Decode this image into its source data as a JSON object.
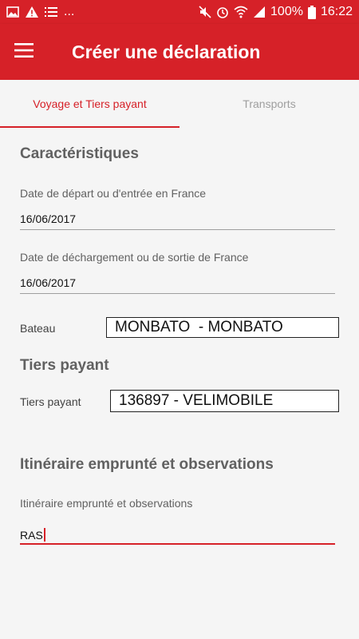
{
  "status_bar": {
    "left_icons": [
      "image-icon",
      "warning-icon",
      "list-icon"
    ],
    "overflow": "...",
    "battery_percent": "100%",
    "time": "16:22"
  },
  "app_bar": {
    "title": "Créer une déclaration"
  },
  "tabs": [
    {
      "label": "Voyage et Tiers payant",
      "active": true
    },
    {
      "label": "Transports",
      "active": false
    }
  ],
  "caracteristiques": {
    "title": "Caractéristiques",
    "date_depart": {
      "label": "Date de départ ou d'entrée en France",
      "value": "16/06/2017"
    },
    "date_dechargement": {
      "label": "Date de déchargement ou de sortie de France",
      "value": "16/06/2017"
    },
    "bateau": {
      "label": "Bateau",
      "value": "MONBATO  - MONBATO"
    }
  },
  "tiers_payant": {
    "title": "Tiers payant",
    "field": {
      "label": "Tiers payant",
      "value": "136897 - VELIMOBILE"
    }
  },
  "itineraire": {
    "title": "Itinéraire emprunté et observations",
    "field": {
      "label": "Itinéraire emprunté et observations",
      "value": "RAS"
    }
  },
  "colors": {
    "accent": "#d62128",
    "background": "#f5f5f5"
  }
}
